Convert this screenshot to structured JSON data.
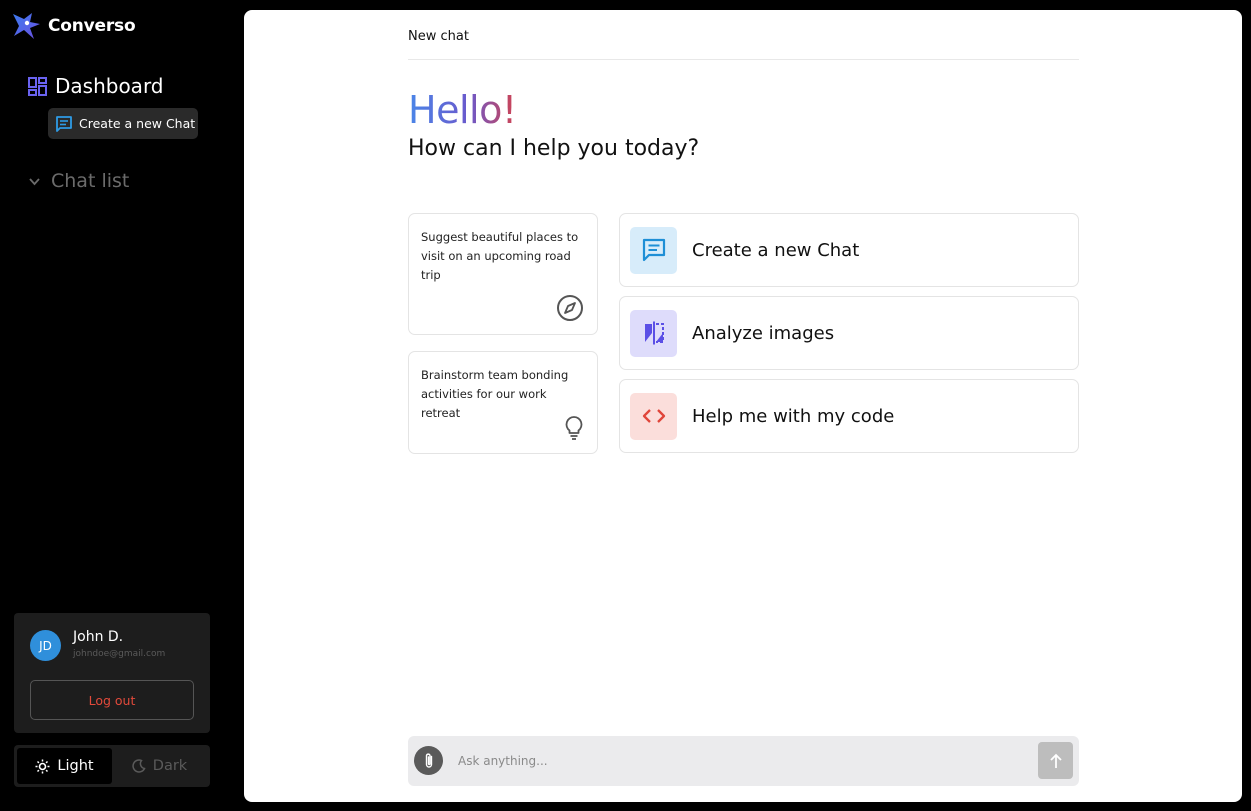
{
  "app": {
    "name": "Converso"
  },
  "sidebar": {
    "dashboard_label": "Dashboard",
    "new_chat_label": "Create a new Chat",
    "chat_list_label": "Chat list"
  },
  "user": {
    "initials": "JD",
    "name": "John D.",
    "email": "johndoe@gmail.com",
    "logout_label": "Log out"
  },
  "theme": {
    "light_label": "Light",
    "dark_label": "Dark",
    "selected": "Light"
  },
  "main": {
    "header_title": "New chat",
    "greeting": "Hello!",
    "subtitle": "How can I help you today?",
    "suggestions": [
      {
        "text": "Suggest beautiful places to visit on an upcoming road trip",
        "icon": "compass-icon"
      },
      {
        "text": "Brainstorm team bonding activities for our work retreat",
        "icon": "lightbulb-icon"
      }
    ],
    "actions": [
      {
        "label": "Create a new Chat",
        "icon": "chat-icon",
        "icon_color": "#1e8fd6",
        "icon_bg": "#d7ecfa"
      },
      {
        "label": "Analyze images",
        "icon": "compare-icon",
        "icon_color": "#5b4fe6",
        "icon_bg": "#dedcfb"
      },
      {
        "label": "Help me with my code",
        "icon": "code-icon",
        "icon_color": "#e0453a",
        "icon_bg": "#fbdedb"
      }
    ]
  },
  "input": {
    "placeholder": "Ask anything..."
  },
  "colors": {
    "accent_blue": "#4a86e8",
    "accent_purple": "#5b4fe6",
    "accent_red": "#e24a3b"
  }
}
